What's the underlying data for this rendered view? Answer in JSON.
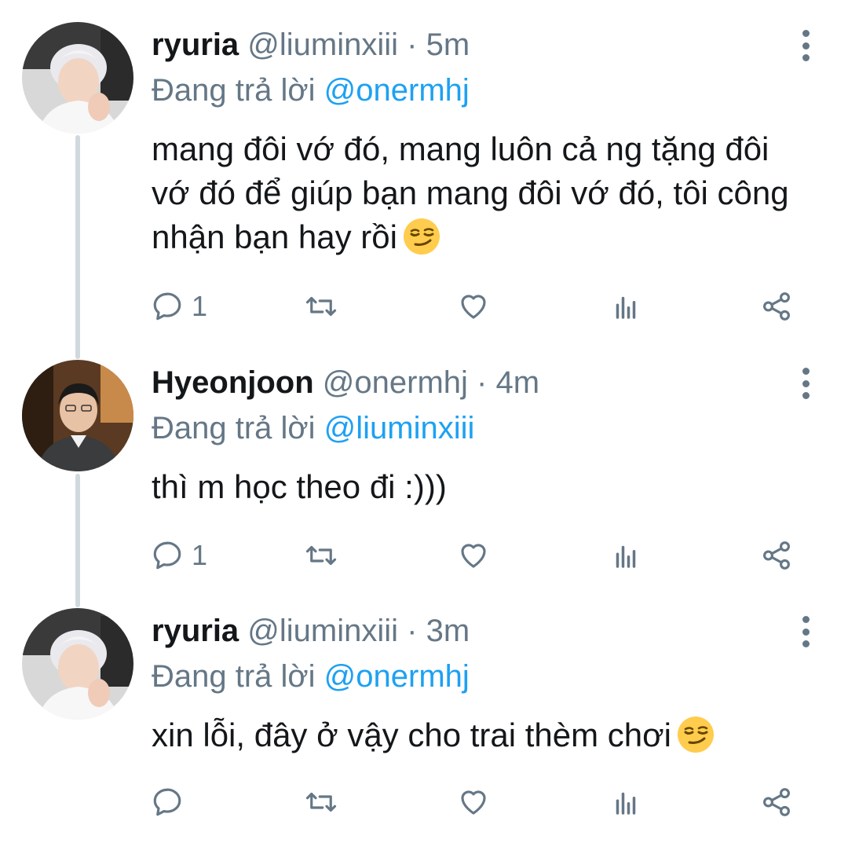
{
  "tweets": [
    {
      "name": "ryuria",
      "handle": "@liuminxiii",
      "time": "5m",
      "reply_prefix": "Đang trả lời ",
      "reply_to": "@onermhj",
      "text": "mang đôi vớ đó, mang luôn cả ng tặng đôi vớ đó để giúp bạn mang đôi vớ đó, tôi công nhận bạn hay rồi",
      "emoji": "smirking-face",
      "reply_count": "1"
    },
    {
      "name": "Hyeonjoon",
      "handle": "@onermhj",
      "time": "4m",
      "reply_prefix": "Đang trả lời ",
      "reply_to": "@liuminxiii",
      "text": "thì m học theo đi :)))",
      "reply_count": "1"
    },
    {
      "name": "ryuria",
      "handle": "@liuminxiii",
      "time": "3m",
      "reply_prefix": "Đang trả lời ",
      "reply_to": "@onermhj",
      "text": "xin lỗi, đây ở vậy cho trai thèm chơi",
      "emoji": "smirking-face",
      "reply_count": ""
    }
  ],
  "separator": " · ",
  "icons": [
    "reply-icon",
    "retweet-icon",
    "like-icon",
    "analytics-icon",
    "share-icon",
    "more-options-icon"
  ],
  "colors": {
    "text": "#14171a",
    "secondary": "#657786",
    "mention": "#1da1f2",
    "thread_line": "#cfd9de"
  }
}
